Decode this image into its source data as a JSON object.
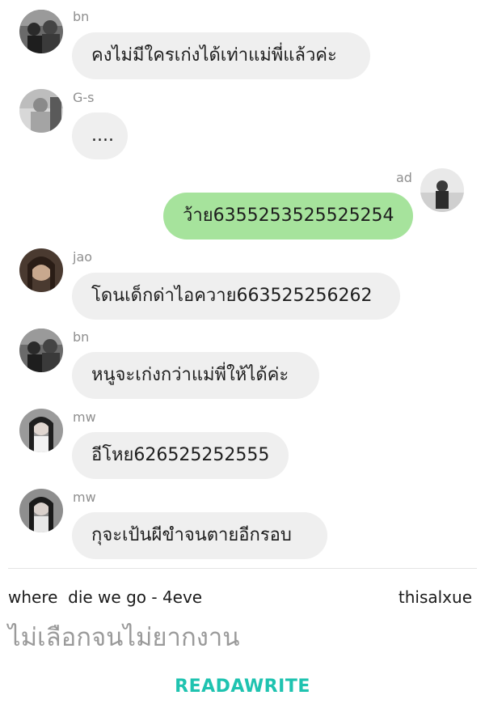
{
  "messages": [
    {
      "sender": "bn",
      "text": "คงไม่มีใครเก่งได้เท่าแม่พี่แล้วค่ะ",
      "side": "in"
    },
    {
      "sender": "G-s",
      "text": "....",
      "side": "in"
    },
    {
      "sender": "ad",
      "text": "ว้าย6355253525525254",
      "side": "out"
    },
    {
      "sender": "jao",
      "text": "โดนเด็กด่าไอควาย663525256262",
      "side": "in"
    },
    {
      "sender": "bn",
      "text": "หนูจะเก่งกว่าแม่พี่ให้ได้ค่ะ",
      "side": "in"
    },
    {
      "sender": "mw",
      "text": "อีโหย626525252555",
      "side": "in"
    },
    {
      "sender": "mw",
      "text": "กุจะเป้นผีขำจนตายอีกรอบ",
      "side": "in"
    }
  ],
  "footer": {
    "song": "where  die we go - 4eve",
    "author": "thisalxue",
    "story_title": "ไม่เลือกจนไม่ยากงาน",
    "brand": "READAWRITE"
  },
  "colors": {
    "incoming_bubble": "#efefef",
    "outgoing_bubble": "#a6e39c",
    "brand": "#1fc3b0",
    "name_text": "#8f8f8f"
  }
}
